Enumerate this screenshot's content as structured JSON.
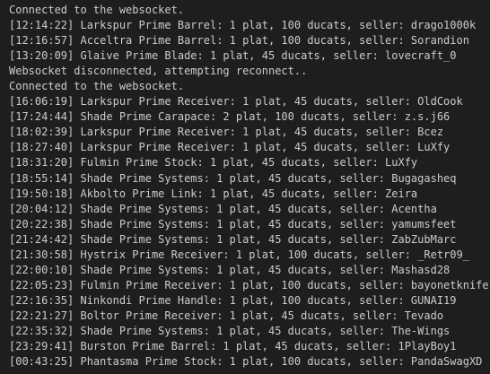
{
  "terminal": {
    "lines": [
      "Connected to the websocket.",
      "[12:14:22] Larkspur Prime Barrel: 1 plat, 100 ducats, seller: drago1000k",
      "[12:16:57] Acceltra Prime Barrel: 1 plat, 100 ducats, seller: Sorandion",
      "[13:20:09] Glaive Prime Blade: 1 plat, 45 ducats, seller: lovecraft_0",
      "Websocket disconnected, attempting reconnect..",
      "Connected to the websocket.",
      "[16:06:19] Larkspur Prime Receiver: 1 plat, 45 ducats, seller: OldCook",
      "[17:24:44] Shade Prime Carapace: 2 plat, 100 ducats, seller: z.s.j66",
      "[18:02:39] Larkspur Prime Receiver: 1 plat, 45 ducats, seller: Bcez",
      "[18:27:40] Larkspur Prime Receiver: 1 plat, 45 ducats, seller: LuXfy",
      "[18:31:20] Fulmin Prime Stock: 1 plat, 45 ducats, seller: LuXfy",
      "[18:55:14] Shade Prime Systems: 1 plat, 45 ducats, seller: Bugagasheq",
      "[19:50:18] Akbolto Prime Link: 1 plat, 45 ducats, seller: Zeira",
      "[20:04:12] Shade Prime Systems: 1 plat, 45 ducats, seller: Acentha",
      "[20:22:38] Shade Prime Systems: 1 plat, 45 ducats, seller: yamumsfeet",
      "[21:24:42] Shade Prime Systems: 1 plat, 45 ducats, seller: ZabZubMarc",
      "[21:30:58] Hystrix Prime Receiver: 1 plat, 100 ducats, seller: _Retr09_",
      "[22:00:10] Shade Prime Systems: 1 plat, 45 ducats, seller: Mashasd28",
      "[22:05:23] Fulmin Prime Receiver: 1 plat, 100 ducats, seller: bayonetknife",
      "[22:16:35] Ninkondi Prime Handle: 1 plat, 100 ducats, seller: GUNAI19",
      "[22:21:27] Boltor Prime Receiver: 1 plat, 45 ducats, seller: Tevado",
      "[22:35:32] Shade Prime Systems: 1 plat, 45 ducats, seller: The-Wings",
      "[23:29:41] Burston Prime Barrel: 1 plat, 45 ducats, seller: 1PlayBoy1",
      "[00:43:25] Phantasma Prime Stock: 1 plat, 100 ducats, seller: PandaSwagXD"
    ]
  }
}
